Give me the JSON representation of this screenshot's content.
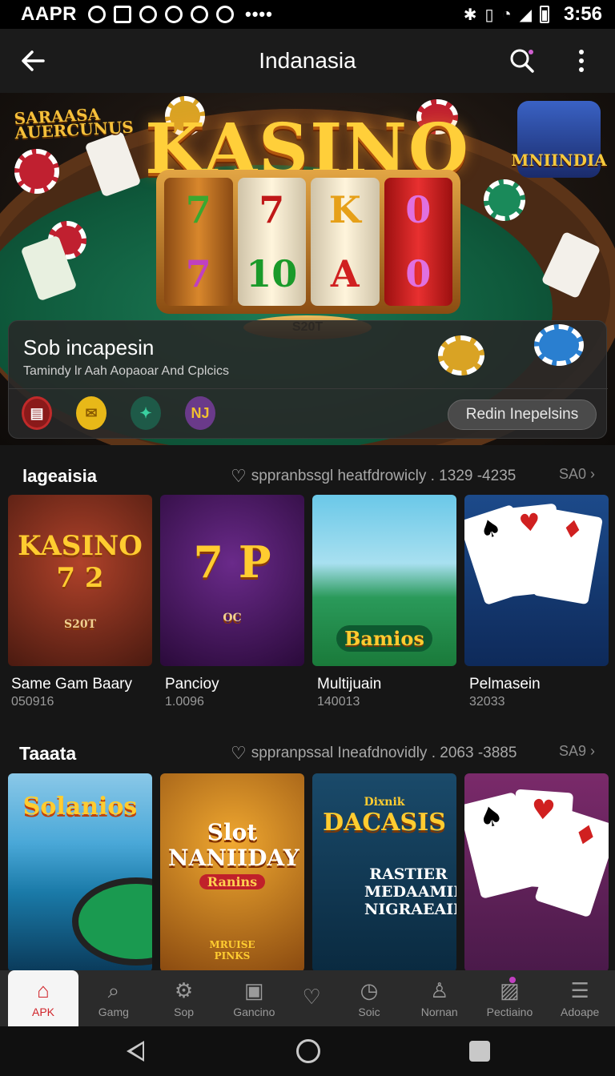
{
  "status_bar": {
    "carrier": "AAPR",
    "time": "3:56",
    "icons": [
      "brightness-icon",
      "image-icon",
      "clock-icon",
      "shield-icon",
      "alarm-icon",
      "bolt-icon"
    ],
    "more": "••••"
  },
  "app_bar": {
    "title": "Indanasia"
  },
  "hero": {
    "logo": "KASINO",
    "badge_left": "SARAASA AUERCUNUS",
    "badge_right": "MNIINDIA",
    "reels": [
      [
        "7",
        "7"
      ],
      [
        "7",
        "10"
      ],
      [
        "K",
        "A"
      ],
      [
        "0",
        "0"
      ]
    ],
    "plate": "S20T"
  },
  "promo": {
    "title": "Sob incapesin",
    "subtitle": "Tamindy lr Aah Aopaoar And Cplcics",
    "icons": [
      "slot-machine-icon",
      "coin-icon",
      "leaf-chip-icon",
      "purple-chip-icon"
    ],
    "icon_text": [
      "",
      "",
      "",
      "NJ"
    ],
    "button": "Redin Inepelsins"
  },
  "section1": {
    "title": "lageaisia",
    "meta": "sppranbssgl heatfdrowicly . 1329 -4235",
    "more": "SA0"
  },
  "section1_tiles": [
    {
      "name": "Same Gam Baary",
      "num": "050916",
      "art": "KASINO 7 2",
      "plate": "S20T"
    },
    {
      "name": "Pancioy",
      "num": "1.0096",
      "art": "7 P",
      "plate": "OC"
    },
    {
      "name": "Multijuain",
      "num": "140013",
      "art": "Bamios"
    },
    {
      "name": "Pelmasein",
      "num": "32033",
      "art": ""
    }
  ],
  "section2": {
    "title": "Taaata",
    "meta": "sppranpssal Ineafdnovidly . 2063 -3885",
    "more": "SA9"
  },
  "section2_tiles": [
    {
      "art": "Solanios"
    },
    {
      "art": "Slot NANIIDAY",
      "sub": "Ranins",
      "art2": "MRUISE",
      "art3": "PINKS"
    },
    {
      "art": "DACASIS",
      "sub": "RASTIER MEDAAMIN NIGRAEAIN",
      "art2": "Dixnik"
    },
    {
      "art": ""
    }
  ],
  "bottom_nav": [
    {
      "label": "APK",
      "icon": "home-icon"
    },
    {
      "label": "Gamg",
      "icon": "search-icon"
    },
    {
      "label": "Sop",
      "icon": "gear-icon"
    },
    {
      "label": "Gancino",
      "icon": "document-icon"
    },
    {
      "label": "",
      "icon": "heart-icon"
    },
    {
      "label": "Soic",
      "icon": "clock-icon"
    },
    {
      "label": "Nornan",
      "icon": "user-icon"
    },
    {
      "label": "Pectiaino",
      "icon": "image-icon"
    },
    {
      "label": "Adoape",
      "icon": "menu-icon"
    }
  ],
  "colors": {
    "accent_red": "#d0242a",
    "gold": "#ffcf3a",
    "felt_green": "#1c7a55"
  }
}
